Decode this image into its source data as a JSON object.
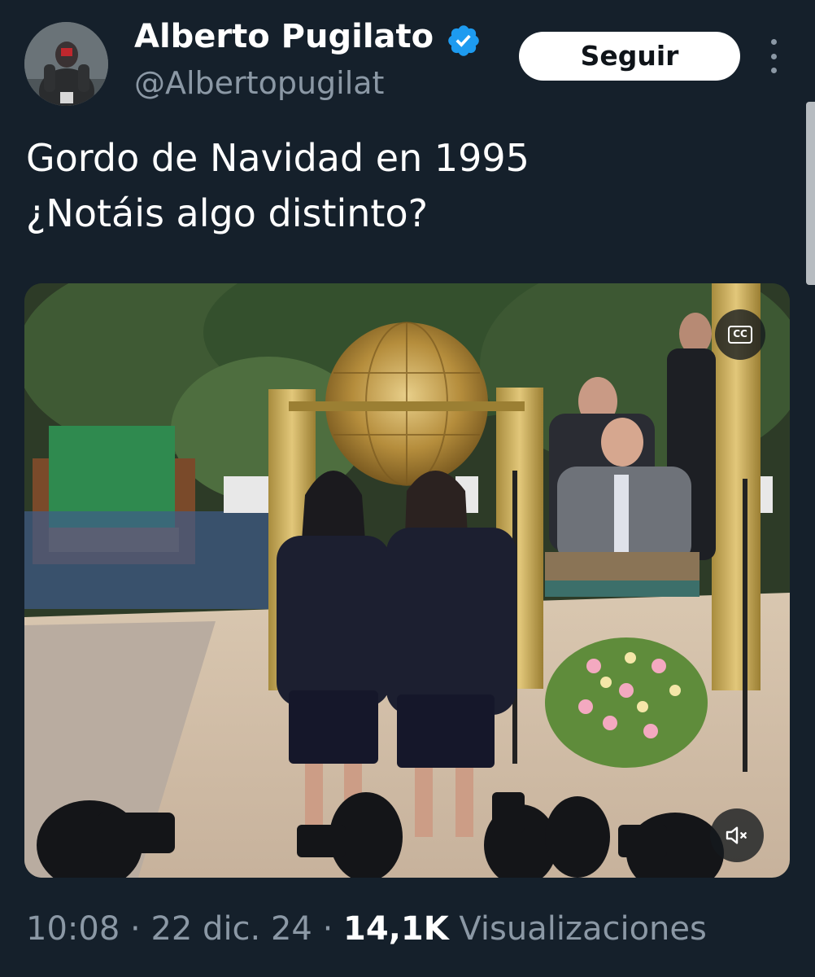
{
  "author": {
    "display_name": "Alberto Pugilato",
    "handle": "@Albertopugilat",
    "verified": true,
    "verified_color": "#1d9bf0"
  },
  "actions": {
    "follow_label": "Seguir"
  },
  "tweet": {
    "lines": [
      "Gordo de Navidad en 1995",
      "¿Notáis algo distinto?"
    ]
  },
  "media": {
    "type": "video",
    "cc_label": "CC",
    "muted": true
  },
  "meta": {
    "time": "10:08",
    "separator": " · ",
    "date": "22 dic. 24",
    "views_count": "14,1K",
    "views_label": " Visualizaciones"
  },
  "colors": {
    "background": "#15202b",
    "text_primary": "#ffffff",
    "text_secondary": "#8b98a5",
    "follow_button_bg": "#ffffff"
  }
}
